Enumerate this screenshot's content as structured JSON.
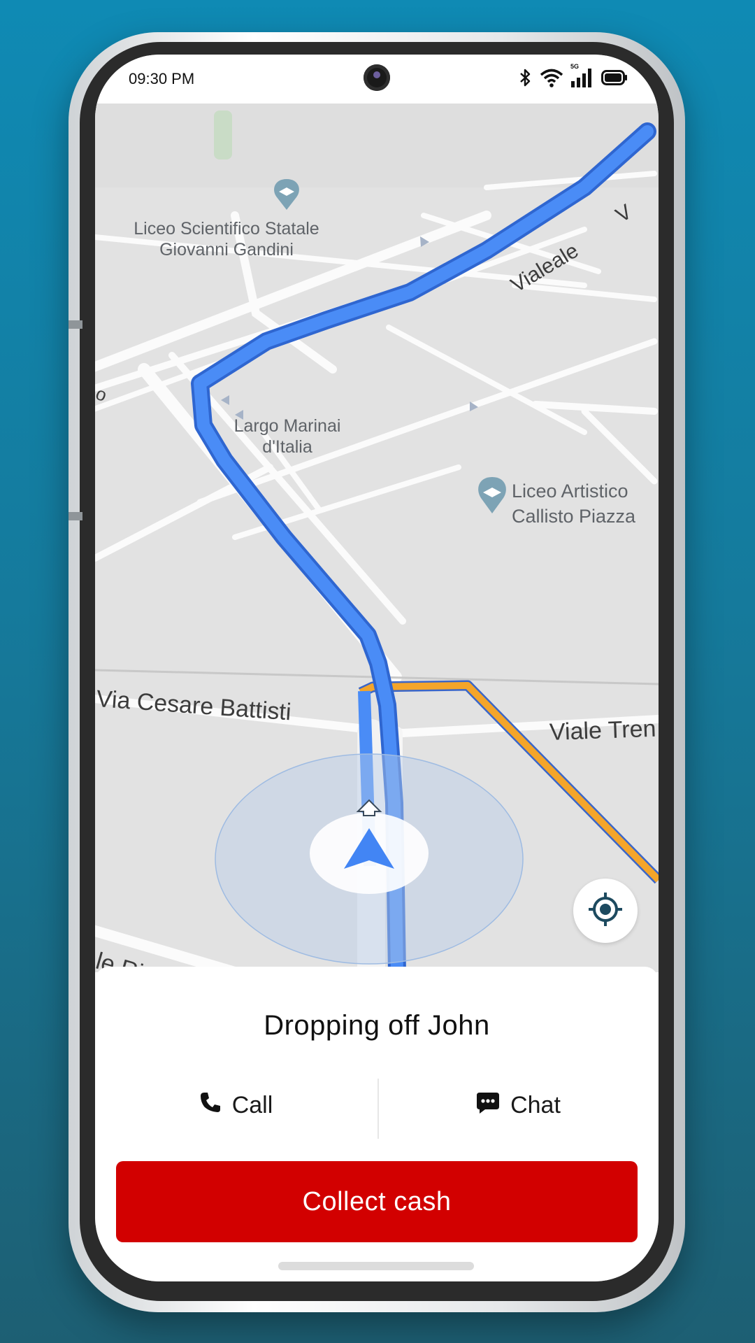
{
  "status_bar": {
    "time": "09:30 PM",
    "icons": [
      "bluetooth-icon",
      "wifi-icon",
      "signal-5g-icon",
      "battery-icon"
    ],
    "network_label": "5G"
  },
  "map": {
    "pois": {
      "top_school": "Liceo Scientifico Statale Giovanni Gandini",
      "top_school_line1": "Liceo Scientifico Statale",
      "top_school_line2": "Giovanni Gandini",
      "top_partial": "nini Gandini",
      "square_line1": "Largo Marinai",
      "square_line2": "d'Italia",
      "art_school_line1": "Liceo Artistico",
      "art_school_line2": "Callisto Piazza",
      "faded_label": "Callisto Piazza"
    },
    "roads": {
      "cesare_battisti": "Via Cesare Battisti",
      "viale_trento": "Viale Tren",
      "rimembranze": "le Rimembra",
      "viale_top": "Vialeale",
      "viale_top2": "V",
      "left_edge": "o"
    },
    "colors": {
      "route": "#4285f4",
      "alt_route": "#f4a52a",
      "map_bg": "#e2e2e2",
      "accuracy_circle": "#b8cde8"
    }
  },
  "trip": {
    "title": "Dropping off John",
    "call_label": "Call",
    "chat_label": "Chat",
    "collect_label": "Collect cash",
    "primary_color": "#d20000"
  }
}
